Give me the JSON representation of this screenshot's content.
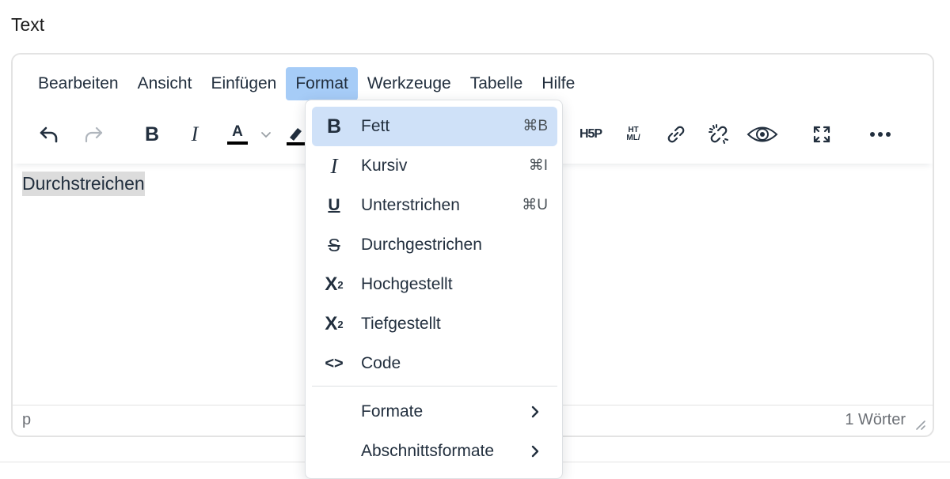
{
  "field_label": "Text",
  "menubar": [
    {
      "label": "Bearbeiten"
    },
    {
      "label": "Ansicht"
    },
    {
      "label": "Einfügen"
    },
    {
      "label": "Format",
      "active": true
    },
    {
      "label": "Werkzeuge"
    },
    {
      "label": "Tabelle"
    },
    {
      "label": "Hilfe"
    }
  ],
  "toolbar": {
    "undo_icon": "undo-icon",
    "redo_icon": "redo-icon",
    "bold_label": "B",
    "italic_label": "I",
    "text_color_label": "A",
    "text_color": "#000000",
    "h5p_label": "H5P",
    "html_label_top": "HT",
    "html_label_bottom": "ML/",
    "more_icon": "more-icon"
  },
  "content": {
    "paragraph": "Durchstreichen"
  },
  "statusbar": {
    "path": "p",
    "word_count": "1 Wörter"
  },
  "format_menu": {
    "items": [
      {
        "label": "Fett",
        "shortcut": "⌘B",
        "icon": "bold-icon",
        "glyph": "B"
      },
      {
        "label": "Kursiv",
        "shortcut": "⌘I",
        "icon": "italic-icon",
        "glyph": "I"
      },
      {
        "label": "Unterstrichen",
        "shortcut": "⌘U",
        "icon": "underline-icon",
        "glyph": "U"
      },
      {
        "label": "Durchgestrichen",
        "shortcut": "",
        "icon": "strikethrough-icon",
        "glyph": "S"
      },
      {
        "label": "Hochgestellt",
        "shortcut": "",
        "icon": "superscript-icon",
        "glyph": "X"
      },
      {
        "label": "Tiefgestellt",
        "shortcut": "",
        "icon": "subscript-icon",
        "glyph": "X"
      },
      {
        "label": "Code",
        "shortcut": "",
        "icon": "code-icon",
        "glyph": "<>"
      }
    ],
    "submenus": [
      {
        "label": "Formate"
      },
      {
        "label": "Abschnittsformate"
      }
    ],
    "sup_mark": "2",
    "sub_mark": "2"
  },
  "colors": {
    "accent": "#a6ccf7",
    "highlight": "#cfe1f8",
    "text": "#222f3e",
    "selection": "#dcdcdc"
  }
}
